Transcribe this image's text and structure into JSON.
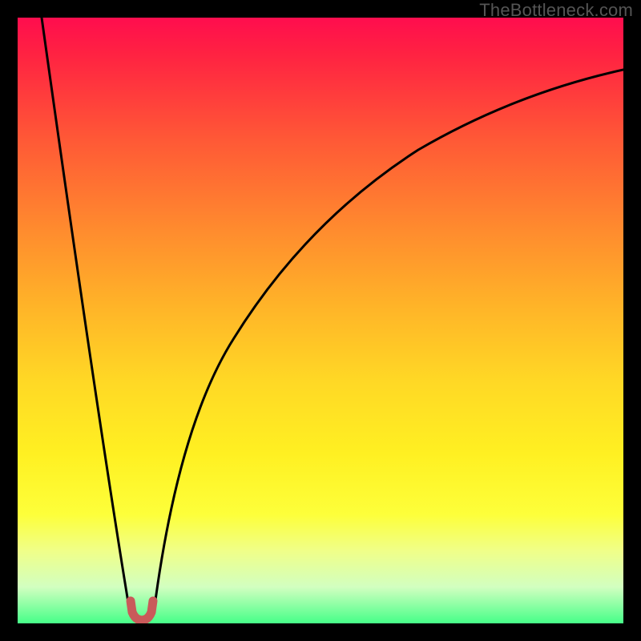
{
  "attribution": "TheBottleneck.com",
  "chart_data": {
    "type": "line",
    "title": "",
    "xlabel": "",
    "ylabel": "",
    "xlim": [
      0,
      1
    ],
    "ylim": [
      0,
      1
    ],
    "curve_left": {
      "description": "steep descent from top-left to notch",
      "x": [
        0.04,
        0.064,
        0.088,
        0.112,
        0.136,
        0.16,
        0.184
      ],
      "y": [
        1.0,
        0.82,
        0.64,
        0.46,
        0.28,
        0.1,
        0.02
      ]
    },
    "curve_right": {
      "description": "asymptotic rise from notch toward upper-right",
      "x": [
        0.225,
        0.28,
        0.34,
        0.4,
        0.48,
        0.56,
        0.64,
        0.72,
        0.8,
        0.88,
        0.96,
        1.0
      ],
      "y": [
        0.02,
        0.27,
        0.44,
        0.56,
        0.67,
        0.745,
        0.8,
        0.84,
        0.87,
        0.892,
        0.908,
        0.915
      ]
    },
    "notch": {
      "description": "red U-shaped marker at minimum",
      "center_x": 0.205,
      "center_y": 0.016,
      "width": 0.035,
      "color": "#c95a5a"
    },
    "gradient_background": {
      "top": "#ff0d4e",
      "bottom": "#46ff88"
    }
  }
}
